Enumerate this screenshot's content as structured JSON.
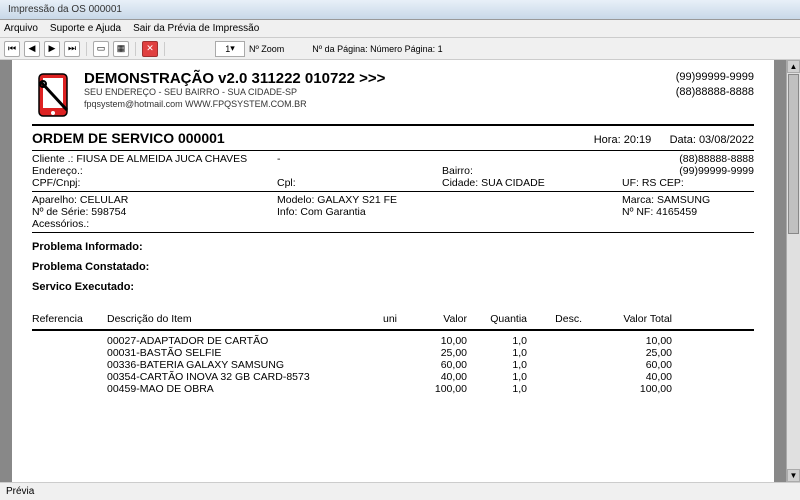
{
  "window": {
    "title": "Impressão da OS 000001"
  },
  "menu": {
    "arquivo": "Arquivo",
    "suporte": "Suporte e Ajuda",
    "sair": "Sair da Prévia de Impressão"
  },
  "toolbar": {
    "zoom_value": "1",
    "zoom_label": "Nº Zoom",
    "page_label": "Nº da Página: Número Página: 1"
  },
  "header": {
    "title": "DEMONSTRAÇÃO v2.0 311222 010722 >>>",
    "sub1": "SEU ENDEREÇO - SEU BAIRRO - SUA CIDADE-SP",
    "sub2": "fpqsystem@hotmail.com  WWW.FPQSYSTEM.COM.BR",
    "phone1": "(99)99999-9999",
    "phone2": "(88)88888-8888"
  },
  "os": {
    "title": "ORDEM DE SERVICO 000001",
    "hora_l": "Hora:",
    "hora_v": "20:19",
    "data_l": "Data:",
    "data_v": "03/08/2022"
  },
  "client": {
    "l_cliente": "Cliente   .:",
    "cliente": "FIUSA DE ALMEIDA JUCA CHAVES",
    "dash": "-",
    "l_endereco": "Endereço.:",
    "l_bairro": "Bairro:",
    "l_cpf": "CPF/Cnpj:",
    "l_cpl": "Cpl:",
    "l_cidade": "Cidade:",
    "cidade": "SUA CIDADE",
    "l_uf": "UF: RS",
    "l_cep": "CEP:",
    "phone_a": "(88)88888-8888",
    "phone_b": "(99)99999-9999"
  },
  "device": {
    "l_aparelho": "Aparelho:",
    "aparelho": "CELULAR",
    "l_modelo": "Modelo:",
    "modelo": "GALAXY S21 FE",
    "l_marca": "Marca:",
    "marca": "SAMSUNG",
    "l_serie": "Nº de Série:",
    "serie": "598754",
    "l_info": "Info:",
    "info": "Com Garantia",
    "l_nf": "Nº NF:",
    "nf": "4165459",
    "l_acess": "Acessórios.:"
  },
  "sections": {
    "prob_inf": "Problema Informado:",
    "prob_con": "Problema Constatado:",
    "serv_exec": "Servico Executado:"
  },
  "items_header": {
    "ref": "Referencia",
    "desc": "Descrição do Item",
    "uni": "uni",
    "valor": "Valor",
    "quant": "Quantia",
    "dsc": "Desc.",
    "total": "Valor Total"
  },
  "items": [
    {
      "desc": "00027-ADAPTADOR DE CARTÃO",
      "valor": "10,00",
      "quant": "1,0",
      "total": "10,00"
    },
    {
      "desc": "00031-BASTÃO SELFIE",
      "valor": "25,00",
      "quant": "1,0",
      "total": "25,00"
    },
    {
      "desc": "00336-BATERIA GALAXY SAMSUNG",
      "valor": "60,00",
      "quant": "1,0",
      "total": "60,00"
    },
    {
      "desc": "00354-CARTÃO INOVA 32 GB CARD-8573",
      "valor": "40,00",
      "quant": "1,0",
      "total": "40,00"
    },
    {
      "desc": "00459-MAO DE OBRA",
      "valor": "100,00",
      "quant": "1,0",
      "total": "100,00"
    }
  ],
  "status": {
    "previa": "Prévia"
  }
}
